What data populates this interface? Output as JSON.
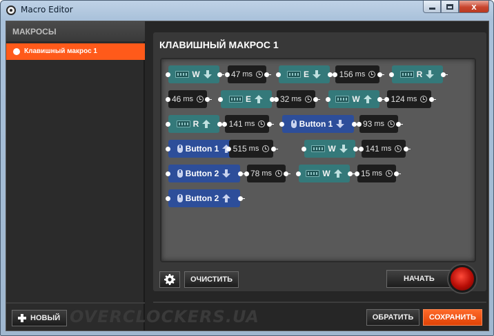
{
  "window": {
    "title": "Macro Editor",
    "minimize_icon": "minimize-icon",
    "maximize_icon": "maximize-icon",
    "close_icon": "close-icon",
    "close_glyph": "x"
  },
  "sidebar": {
    "header": "МАКРОСЫ",
    "items": [
      {
        "label": "Клавишный макрос 1",
        "selected": true
      }
    ],
    "new_button_label": "НОВЫЙ"
  },
  "main": {
    "title": "КЛАВИШНЫЙ МАКРОС 1",
    "unit": "ms",
    "rows": [
      [
        {
          "type": "key",
          "label": "W",
          "dir": "down"
        },
        {
          "type": "delay",
          "value": "47"
        },
        {
          "type": "key",
          "label": "E",
          "dir": "down"
        },
        {
          "type": "delay",
          "value": "156"
        },
        {
          "type": "key",
          "label": "R",
          "dir": "down"
        }
      ],
      [
        {
          "type": "delay",
          "value": "46"
        },
        {
          "type": "key",
          "label": "E",
          "dir": "up"
        },
        {
          "type": "delay",
          "value": "32"
        },
        {
          "type": "key",
          "label": "W",
          "dir": "up"
        },
        {
          "type": "delay",
          "value": "124"
        }
      ],
      [
        {
          "type": "key",
          "label": "R",
          "dir": "up"
        },
        {
          "type": "delay",
          "value": "141"
        },
        {
          "type": "mouse",
          "label": "Button 1",
          "dir": "down"
        },
        {
          "type": "delay",
          "value": "93"
        }
      ],
      [
        {
          "type": "mouse",
          "label": "Button 1",
          "dir": "up"
        },
        {
          "type": "delay",
          "value": "515"
        },
        {
          "type": "key",
          "label": "W",
          "dir": "down"
        },
        {
          "type": "delay",
          "value": "141"
        }
      ],
      [
        {
          "type": "mouse",
          "label": "Button 2",
          "dir": "down"
        },
        {
          "type": "delay",
          "value": "78"
        },
        {
          "type": "key",
          "label": "W",
          "dir": "up"
        },
        {
          "type": "delay",
          "value": "15"
        }
      ],
      [
        {
          "type": "mouse",
          "label": "Button 2",
          "dir": "up"
        }
      ]
    ],
    "clear_button_label": "ОЧИСТИТЬ",
    "start_button_label": "НАЧАТЬ",
    "settings_icon": "gear-icon"
  },
  "footer": {
    "watermark": "OVERCLOCKERS.UA",
    "revert_button_label": "ОБРАТИТЬ",
    "save_button_label": "СОХРАНИТЬ"
  },
  "colors": {
    "accent": "#ff5a1a",
    "key_block": "#34797a",
    "mouse_block": "#2d4e9a",
    "delay_block": "#1d1d1d"
  }
}
